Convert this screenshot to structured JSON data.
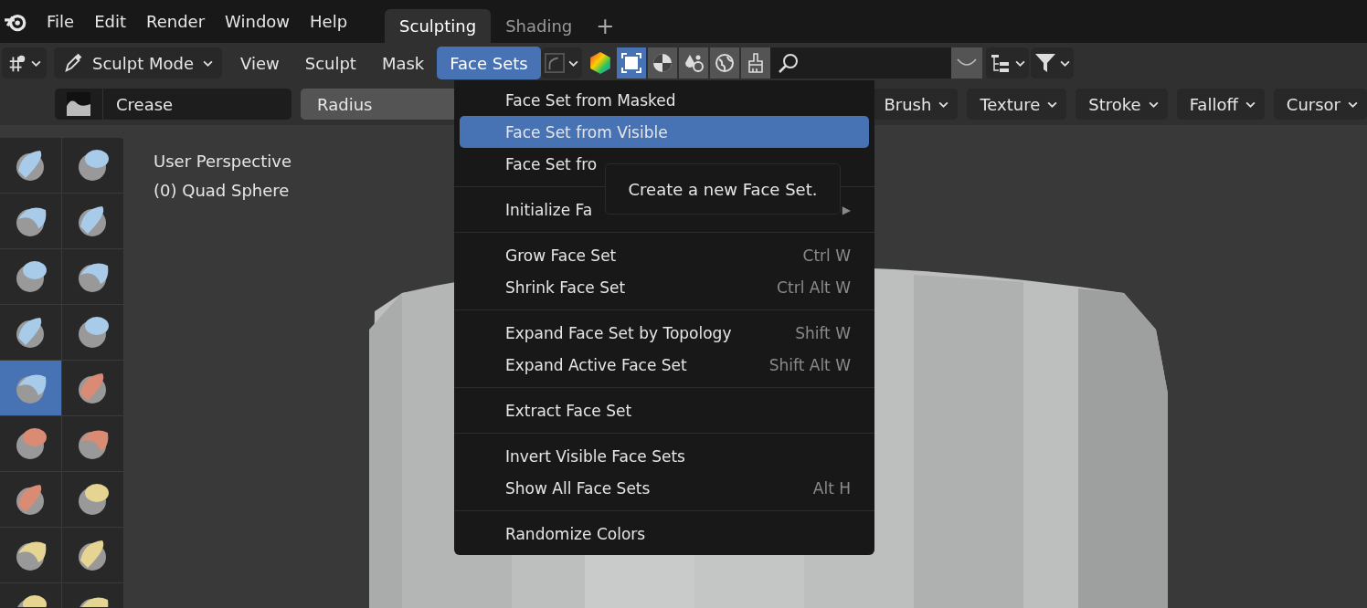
{
  "top_menu": [
    "File",
    "Edit",
    "Render",
    "Window",
    "Help"
  ],
  "workspaces": [
    {
      "label": "Sculpting",
      "selected": true
    },
    {
      "label": "Shading",
      "selected": false
    }
  ],
  "add_workspace": "+",
  "header": {
    "mode": "Sculpt Mode",
    "menus": [
      {
        "label": "View",
        "selected": false
      },
      {
        "label": "Sculpt",
        "selected": false
      },
      {
        "label": "Mask",
        "selected": false
      },
      {
        "label": "Face Sets",
        "selected": true
      }
    ]
  },
  "tool_settings": {
    "brush": "Crease",
    "radius": {
      "label": "Radius",
      "level": 1
    },
    "popovers": [
      "Brush",
      "Texture",
      "Stroke",
      "Falloff",
      "Cursor"
    ]
  },
  "viewport": {
    "view": "User Perspective",
    "object": "(0) Quad Sphere"
  },
  "tools": [
    {
      "selected": false,
      "color": "#a7cbe9"
    },
    {
      "selected": false,
      "color": "#a7cbe9"
    },
    {
      "selected": false,
      "color": "#a7cbe9"
    },
    {
      "selected": false,
      "color": "#a7cbe9"
    },
    {
      "selected": false,
      "color": "#a7cbe9"
    },
    {
      "selected": false,
      "color": "#a7cbe9"
    },
    {
      "selected": false,
      "color": "#a7cbe9"
    },
    {
      "selected": false,
      "color": "#a7cbe9"
    },
    {
      "selected": true,
      "color": "#a7cbe9"
    },
    {
      "selected": false,
      "color": "#d98b74"
    },
    {
      "selected": false,
      "color": "#d98b74"
    },
    {
      "selected": false,
      "color": "#d98b74"
    },
    {
      "selected": false,
      "color": "#d98b74"
    },
    {
      "selected": false,
      "color": "#e6d592"
    },
    {
      "selected": false,
      "color": "#e6d592"
    },
    {
      "selected": false,
      "color": "#e6d592"
    },
    {
      "selected": false,
      "color": "#e6d592"
    },
    {
      "selected": false,
      "color": "#e6d592"
    }
  ],
  "face_sets_menu": [
    {
      "kind": "item",
      "label": "Face Set from Masked",
      "selected": false
    },
    {
      "kind": "item",
      "label": "Face Set from Visible",
      "selected": true
    },
    {
      "kind": "item",
      "label": "Face Set fro",
      "selected": false
    },
    {
      "kind": "separator"
    },
    {
      "kind": "submenu",
      "label": "Initialize Fa",
      "selected": false,
      "arrow": "▶"
    },
    {
      "kind": "separator"
    },
    {
      "kind": "item",
      "label": "Grow Face Set",
      "shortcut": "Ctrl W",
      "selected": false
    },
    {
      "kind": "item",
      "label": "Shrink Face Set",
      "shortcut": "Ctrl Alt W",
      "selected": false
    },
    {
      "kind": "separator"
    },
    {
      "kind": "item",
      "label": "Expand Face Set by Topology",
      "shortcut": "Shift W",
      "selected": false
    },
    {
      "kind": "item",
      "label": "Expand Active Face Set",
      "shortcut": "Shift Alt W",
      "selected": false
    },
    {
      "kind": "separator"
    },
    {
      "kind": "item",
      "label": "Extract Face Set",
      "selected": false
    },
    {
      "kind": "separator"
    },
    {
      "kind": "item",
      "label": "Invert Visible Face Sets",
      "selected": false
    },
    {
      "kind": "item",
      "label": "Show All Face Sets",
      "shortcut": "Alt H",
      "selected": false
    },
    {
      "kind": "separator"
    },
    {
      "kind": "item",
      "label": "Randomize Colors",
      "selected": false
    }
  ],
  "tooltip": "Create a new Face Set."
}
